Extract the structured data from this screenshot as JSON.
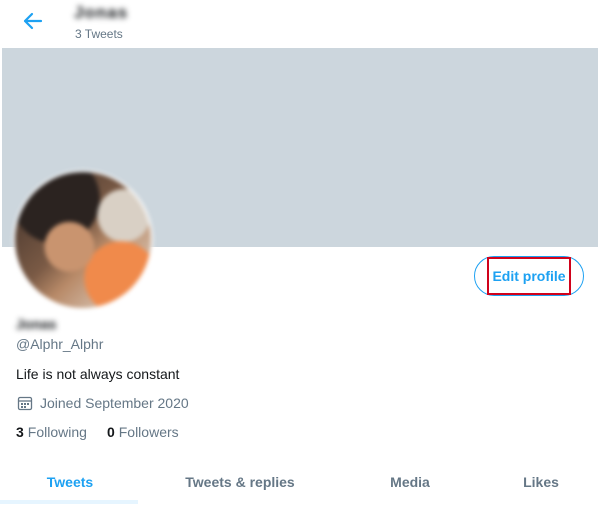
{
  "header": {
    "back_icon": "arrow-left-icon",
    "name": "Jonas",
    "tweet_count": "3 Tweets"
  },
  "profile": {
    "display_name": "Jonas",
    "handle": "@Alphr_Alphr",
    "bio": "Life is not always constant",
    "joined_icon": "calendar-icon",
    "joined": "Joined September 2020",
    "following_count": "3",
    "following_label": "Following",
    "followers_count": "0",
    "followers_label": "Followers",
    "edit_label": "Edit profile"
  },
  "tabs": [
    {
      "label": "Tweets",
      "active": true
    },
    {
      "label": "Tweets & replies",
      "active": false
    },
    {
      "label": "Media",
      "active": false
    },
    {
      "label": "Likes",
      "active": false
    }
  ],
  "colors": {
    "accent": "#1da1f2",
    "banner": "#ccd6dd",
    "muted": "#657786",
    "highlight": "#d0021b"
  }
}
